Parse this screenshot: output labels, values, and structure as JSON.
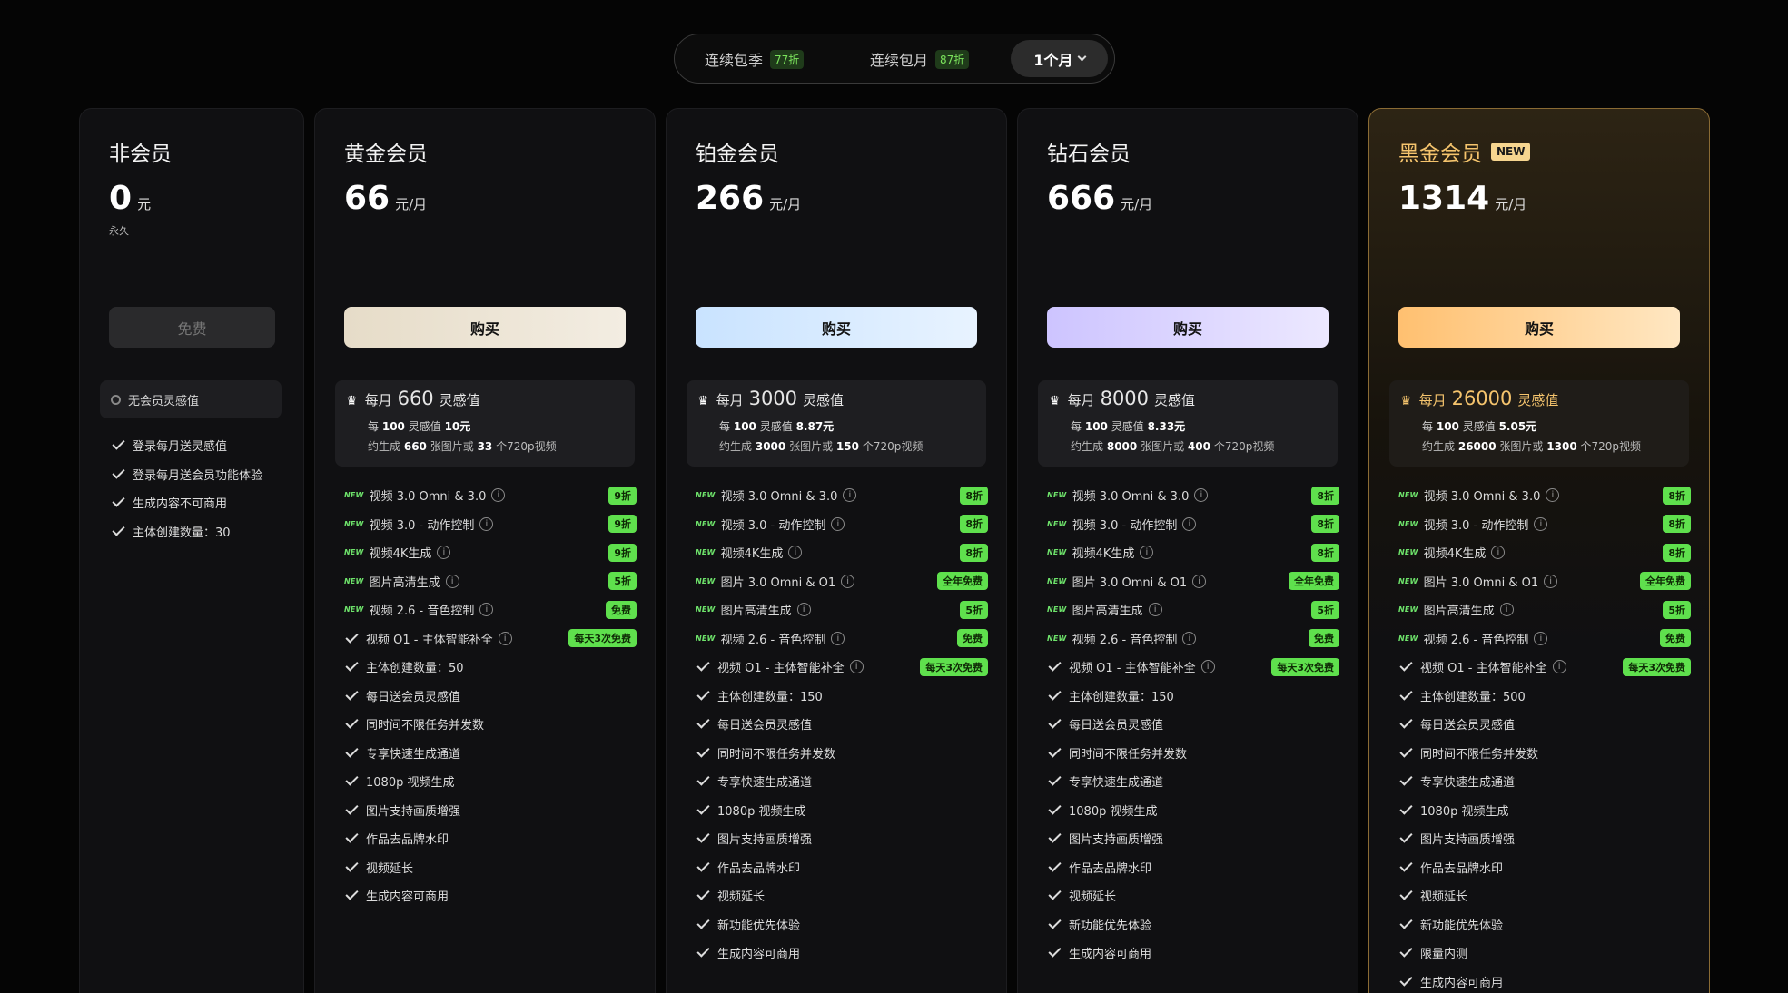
{
  "billing": {
    "quarterly_label": "连续包季",
    "quarterly_discount": "77折",
    "monthly_label": "连续包月",
    "monthly_discount": "87折",
    "selected_label": "1个月"
  },
  "free_plan": {
    "name": "非会员",
    "price": "0",
    "unit": "元",
    "period": "永久",
    "button": "免费",
    "points_text": "无会员灵感值",
    "features": [
      "登录每月送灵感值",
      "登录每月送会员功能体验",
      "生成内容不可商用",
      "主体创建数量：30"
    ]
  },
  "plans": [
    {
      "name": "黄金会员",
      "price": "66",
      "unit": "元/月",
      "button": "购买",
      "points_prefix": "每月",
      "points": "660",
      "points_suffix": "灵感值",
      "unit_price_pre": "每",
      "unit_price_amt": "100",
      "unit_price_mid": "灵感值",
      "unit_price": "10元",
      "gen_pre": "约生成",
      "gen_images": "660",
      "gen_mid": "张图片或",
      "gen_videos": "33",
      "gen_post": "个720p视频",
      "features": [
        {
          "new": "NEW",
          "text": "视频 3.0 Omni & 3.0",
          "info": "i",
          "badge": "9折"
        },
        {
          "new": "NEW",
          "text": "视频 3.0 - 动作控制",
          "info": "i",
          "badge": "9折"
        },
        {
          "new": "NEW",
          "text": "视频4K生成",
          "info": "i",
          "badge": "9折"
        },
        {
          "new": "NEW",
          "text": "图片高清生成",
          "info": "i",
          "badge": "5折"
        },
        {
          "new": "NEW",
          "text": "视频 2.6 - 音色控制",
          "info": "i",
          "badge": "免费"
        },
        {
          "text": "视频 O1 - 主体智能补全",
          "info": "i",
          "badge": "每天3次免费"
        },
        {
          "text": "主体创建数量：50"
        },
        {
          "text": "每日送会员灵感值"
        },
        {
          "text": "同时间不限任务并发数"
        },
        {
          "text": "专享快速生成通道"
        },
        {
          "text": "1080p 视频生成"
        },
        {
          "text": "图片支持画质增强"
        },
        {
          "text": "作品去品牌水印"
        },
        {
          "text": "视频延长"
        },
        {
          "text": "生成内容可商用"
        }
      ]
    },
    {
      "name": "铂金会员",
      "price": "266",
      "unit": "元/月",
      "button": "购买",
      "points_prefix": "每月",
      "points": "3000",
      "points_suffix": "灵感值",
      "unit_price_pre": "每",
      "unit_price_amt": "100",
      "unit_price_mid": "灵感值",
      "unit_price": "8.87元",
      "gen_pre": "约生成",
      "gen_images": "3000",
      "gen_mid": "张图片或",
      "gen_videos": "150",
      "gen_post": "个720p视频",
      "features": [
        {
          "new": "NEW",
          "text": "视频 3.0 Omni & 3.0",
          "info": "i",
          "badge": "8折"
        },
        {
          "new": "NEW",
          "text": "视频 3.0 - 动作控制",
          "info": "i",
          "badge": "8折"
        },
        {
          "new": "NEW",
          "text": "视频4K生成",
          "info": "i",
          "badge": "8折"
        },
        {
          "new": "NEW",
          "text": "图片 3.0 Omni & O1",
          "info": "i",
          "badge": "全年免费"
        },
        {
          "new": "NEW",
          "text": "图片高清生成",
          "info": "i",
          "badge": "5折"
        },
        {
          "new": "NEW",
          "text": "视频 2.6 - 音色控制",
          "info": "i",
          "badge": "免费"
        },
        {
          "text": "视频 O1 - 主体智能补全",
          "info": "i",
          "badge": "每天3次免费"
        },
        {
          "text": "主体创建数量：150"
        },
        {
          "text": "每日送会员灵感值"
        },
        {
          "text": "同时间不限任务并发数"
        },
        {
          "text": "专享快速生成通道"
        },
        {
          "text": "1080p 视频生成"
        },
        {
          "text": "图片支持画质增强"
        },
        {
          "text": "作品去品牌水印"
        },
        {
          "text": "视频延长"
        },
        {
          "text": "新功能优先体验"
        },
        {
          "text": "生成内容可商用"
        }
      ]
    },
    {
      "name": "钻石会员",
      "price": "666",
      "unit": "元/月",
      "button": "购买",
      "points_prefix": "每月",
      "points": "8000",
      "points_suffix": "灵感值",
      "unit_price_pre": "每",
      "unit_price_amt": "100",
      "unit_price_mid": "灵感值",
      "unit_price": "8.33元",
      "gen_pre": "约生成",
      "gen_images": "8000",
      "gen_mid": "张图片或",
      "gen_videos": "400",
      "gen_post": "个720p视频",
      "features": [
        {
          "new": "NEW",
          "text": "视频 3.0 Omni & 3.0",
          "info": "i",
          "badge": "8折"
        },
        {
          "new": "NEW",
          "text": "视频 3.0 - 动作控制",
          "info": "i",
          "badge": "8折"
        },
        {
          "new": "NEW",
          "text": "视频4K生成",
          "info": "i",
          "badge": "8折"
        },
        {
          "new": "NEW",
          "text": "图片 3.0 Omni & O1",
          "info": "i",
          "badge": "全年免费"
        },
        {
          "new": "NEW",
          "text": "图片高清生成",
          "info": "i",
          "badge": "5折"
        },
        {
          "new": "NEW",
          "text": "视频 2.6 - 音色控制",
          "info": "i",
          "badge": "免费"
        },
        {
          "text": "视频 O1 - 主体智能补全",
          "info": "i",
          "badge": "每天3次免费"
        },
        {
          "text": "主体创建数量：150"
        },
        {
          "text": "每日送会员灵感值"
        },
        {
          "text": "同时间不限任务并发数"
        },
        {
          "text": "专享快速生成通道"
        },
        {
          "text": "1080p 视频生成"
        },
        {
          "text": "图片支持画质增强"
        },
        {
          "text": "作品去品牌水印"
        },
        {
          "text": "视频延长"
        },
        {
          "text": "新功能优先体验"
        },
        {
          "text": "生成内容可商用"
        }
      ]
    },
    {
      "name": "黑金会员",
      "tag": "NEW",
      "price": "1314",
      "unit": "元/月",
      "button": "购买",
      "points_prefix": "每月",
      "points": "26000",
      "points_suffix": "灵感值",
      "unit_price_pre": "每",
      "unit_price_amt": "100",
      "unit_price_mid": "灵感值",
      "unit_price": "5.05元",
      "gen_pre": "约生成",
      "gen_images": "26000",
      "gen_mid": "张图片或",
      "gen_videos": "1300",
      "gen_post": "个720p视频",
      "features": [
        {
          "new": "NEW",
          "text": "视频 3.0 Omni & 3.0",
          "info": "i",
          "badge": "8折"
        },
        {
          "new": "NEW",
          "text": "视频 3.0 - 动作控制",
          "info": "i",
          "badge": "8折"
        },
        {
          "new": "NEW",
          "text": "视频4K生成",
          "info": "i",
          "badge": "8折"
        },
        {
          "new": "NEW",
          "text": "图片 3.0 Omni & O1",
          "info": "i",
          "badge": "全年免费"
        },
        {
          "new": "NEW",
          "text": "图片高清生成",
          "info": "i",
          "badge": "5折"
        },
        {
          "new": "NEW",
          "text": "视频 2.6 - 音色控制",
          "info": "i",
          "badge": "免费"
        },
        {
          "text": "视频 O1 - 主体智能补全",
          "info": "i",
          "badge": "每天3次免费"
        },
        {
          "text": "主体创建数量：500"
        },
        {
          "text": "每日送会员灵感值"
        },
        {
          "text": "同时间不限任务并发数"
        },
        {
          "text": "专享快速生成通道"
        },
        {
          "text": "1080p 视频生成"
        },
        {
          "text": "图片支持画质增强"
        },
        {
          "text": "作品去品牌水印"
        },
        {
          "text": "视频延长"
        },
        {
          "text": "新功能优先体验"
        },
        {
          "text": "限量内测"
        },
        {
          "text": "生成内容可商用"
        }
      ]
    }
  ]
}
